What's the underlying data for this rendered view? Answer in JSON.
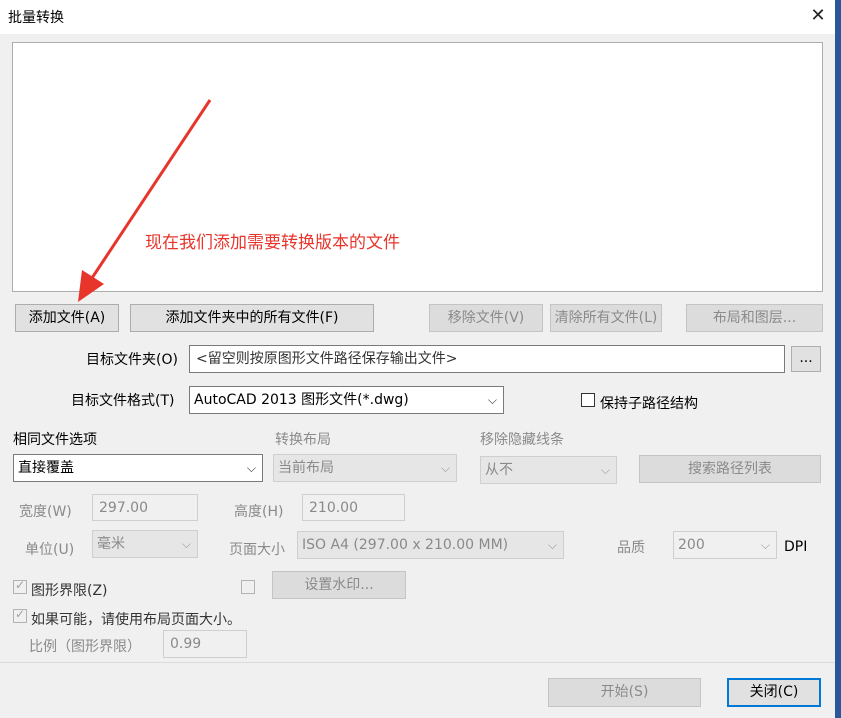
{
  "window": {
    "title": "批量转换",
    "close_glyph": "✕"
  },
  "annotation": {
    "text": "现在我们添加需要转换版本的文件",
    "color": "#e8352c"
  },
  "buttons": {
    "add_file": "添加文件(A)",
    "add_folder": "添加文件夹中的所有文件(F)",
    "remove_file": "移除文件(V)",
    "clear_all": "清除所有文件(L)",
    "layout_layers": "布局和图层...",
    "browse": "...",
    "search_paths": "搜索路径列表",
    "watermark": "设置水印...",
    "start": "开始(S)",
    "close": "关闭(C)"
  },
  "target_folder": {
    "label": "目标文件夹(O)",
    "placeholder": "<留空则按原图形文件路径保存输出文件>"
  },
  "target_format": {
    "label": "目标文件格式(T)",
    "value": "AutoCAD 2013 图形文件(*.dwg)"
  },
  "keep_subpath": {
    "label": "保持子路径结构",
    "checked": false
  },
  "same_file_option": {
    "label": "相同文件选项",
    "value": "直接覆盖"
  },
  "convert_layout": {
    "label": "转换布局",
    "value": "当前布局"
  },
  "remove_hidden": {
    "label": "移除隐藏线条",
    "value": "从不"
  },
  "width": {
    "label": "宽度(W)",
    "value": "297.00"
  },
  "height": {
    "label": "高度(H)",
    "value": "210.00"
  },
  "unit": {
    "label": "单位(U)",
    "value": "毫米"
  },
  "page_size": {
    "label": "页面大小",
    "value": "ISO A4 (297.00 x 210.00 MM)"
  },
  "quality": {
    "label": "品质",
    "value": "200",
    "unit": "DPI"
  },
  "extents": {
    "label": "图形界限(Z)",
    "checked": true
  },
  "watermark_enabled": {
    "checked": false
  },
  "use_layout_size": {
    "label": "如果可能，请使用布局页面大小。",
    "checked": true
  },
  "scale": {
    "label": "比例（图形界限）",
    "value": "0.99"
  },
  "colors": {
    "accent": "#0078d7",
    "side_strip": "#2b579a"
  }
}
